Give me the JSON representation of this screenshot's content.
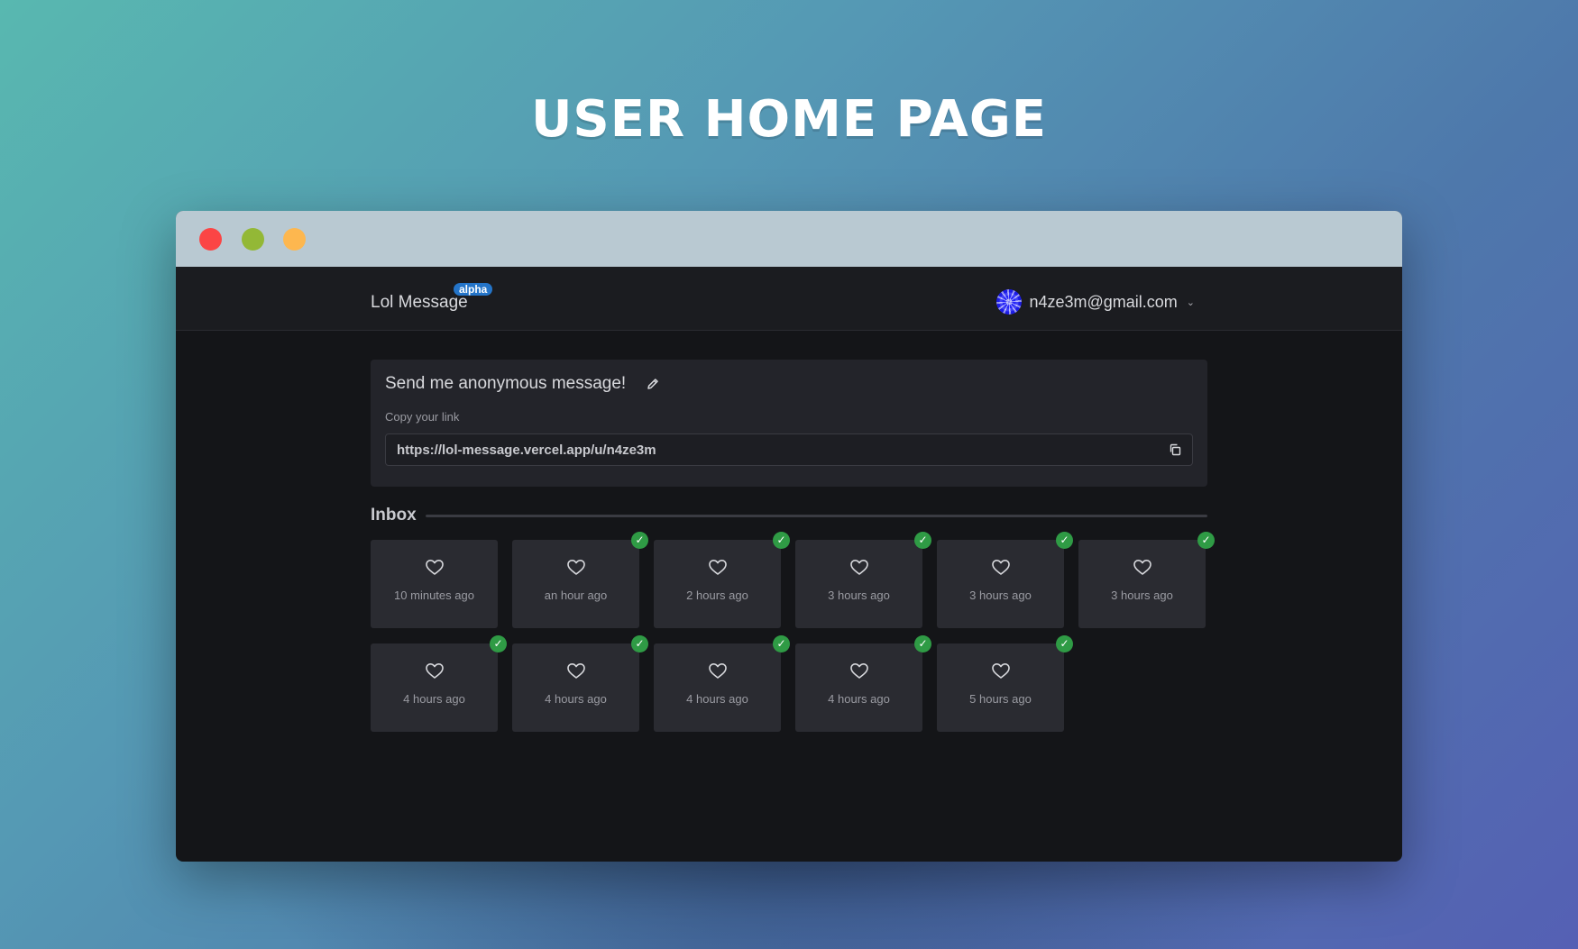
{
  "hero": {
    "title": "User Home Page"
  },
  "app": {
    "brand": "Lol Message",
    "badge": "alpha",
    "user_email": "n4ze3m@gmail.com"
  },
  "profile_card": {
    "title": "Send me anonymous message!",
    "copy_label": "Copy your link",
    "link": "https://lol-message.vercel.app/u/n4ze3m"
  },
  "inbox": {
    "title": "Inbox",
    "messages": [
      {
        "time": "10 minutes ago",
        "read": false
      },
      {
        "time": "an hour ago",
        "read": true
      },
      {
        "time": "2 hours ago",
        "read": true
      },
      {
        "time": "3 hours ago",
        "read": true
      },
      {
        "time": "3 hours ago",
        "read": true
      },
      {
        "time": "3 hours ago",
        "read": true
      },
      {
        "time": "4 hours ago",
        "read": true
      },
      {
        "time": "4 hours ago",
        "read": true
      },
      {
        "time": "4 hours ago",
        "read": true
      },
      {
        "time": "4 hours ago",
        "read": true
      },
      {
        "time": "5 hours ago",
        "read": true
      }
    ]
  },
  "icons": {
    "window_controls": [
      "close-dot",
      "minimize-dot",
      "maximize-dot"
    ],
    "edit": "pencil-icon",
    "copy": "copy-icon",
    "message": "heart-icon",
    "read": "check-icon",
    "dropdown": "chevron-down-icon"
  },
  "colors": {
    "read_badge": "#2f9b45",
    "alpha_badge": "#2474c8",
    "window_close": "#fb4545",
    "window_minimize": "#93b836",
    "window_maximize": "#fdb74f"
  }
}
